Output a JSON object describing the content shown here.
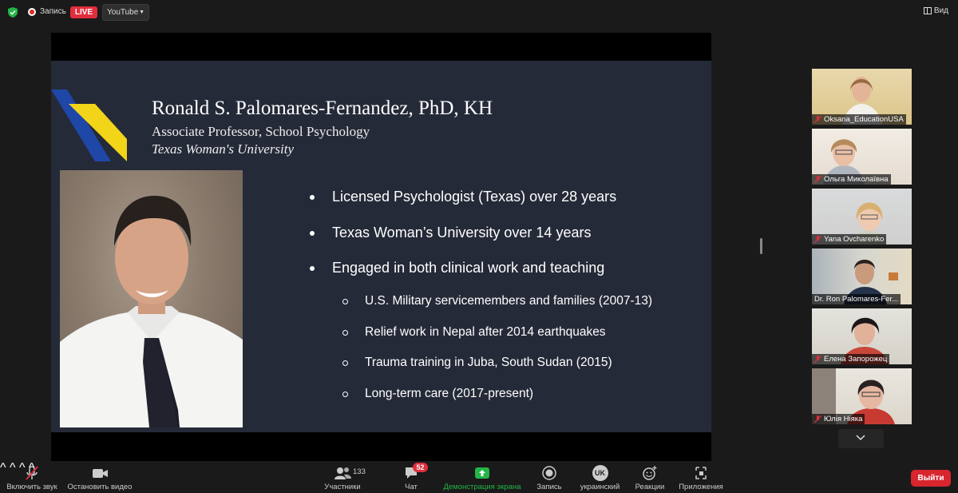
{
  "top_bar": {
    "recording_label": "Запись",
    "live_label": "LIVE",
    "stream_target": "YouTube",
    "view_label": "Вид"
  },
  "slide": {
    "title": "Ronald S. Palomares-Fernandez, PhD, KH",
    "subtitle": "Associate Professor, School Psychology",
    "university": "Texas Woman's University",
    "bullets": [
      "Licensed Psychologist (Texas) over 28 years",
      "Texas Woman’s University over 14 years",
      "Engaged in both clinical work and teaching"
    ],
    "sub_bullets": [
      "U.S. Military servicemembers and families (2007-13)",
      "Relief work in Nepal after 2014 earthquakes",
      "Trauma training in Juba, South Sudan (2015)",
      "Long-term care (2017-present)"
    ],
    "logo_colors": {
      "blue": "#1f47a8",
      "yellow": "#f2d419"
    }
  },
  "participants": [
    {
      "name": "Oksana_EducationUSA",
      "muted": true
    },
    {
      "name": "Ольга Миколаївна",
      "muted": true
    },
    {
      "name": "Yana Ovcharenko",
      "muted": true
    },
    {
      "name": "Dr. Ron Palomares-Fer...",
      "muted": false
    },
    {
      "name": "Елена Запорожец",
      "muted": true
    },
    {
      "name": "Юлія Ніяка",
      "muted": true
    }
  ],
  "toolbar": {
    "unmute_label": "Включить звук",
    "video_label": "Остановить видео",
    "participants_label": "Участники",
    "participants_count": "133",
    "chat_label": "Чат",
    "chat_badge": "52",
    "share_label": "Демонстрация экрана",
    "record_label": "Запись",
    "language_code": "UK",
    "language_label": "украинский",
    "reactions_label": "Реакции",
    "apps_label": "Приложения",
    "leave_label": "Выйти"
  },
  "colors": {
    "accent_green": "#23b545",
    "danger_red": "#e02e3d",
    "slide_bg": "#252a38"
  }
}
